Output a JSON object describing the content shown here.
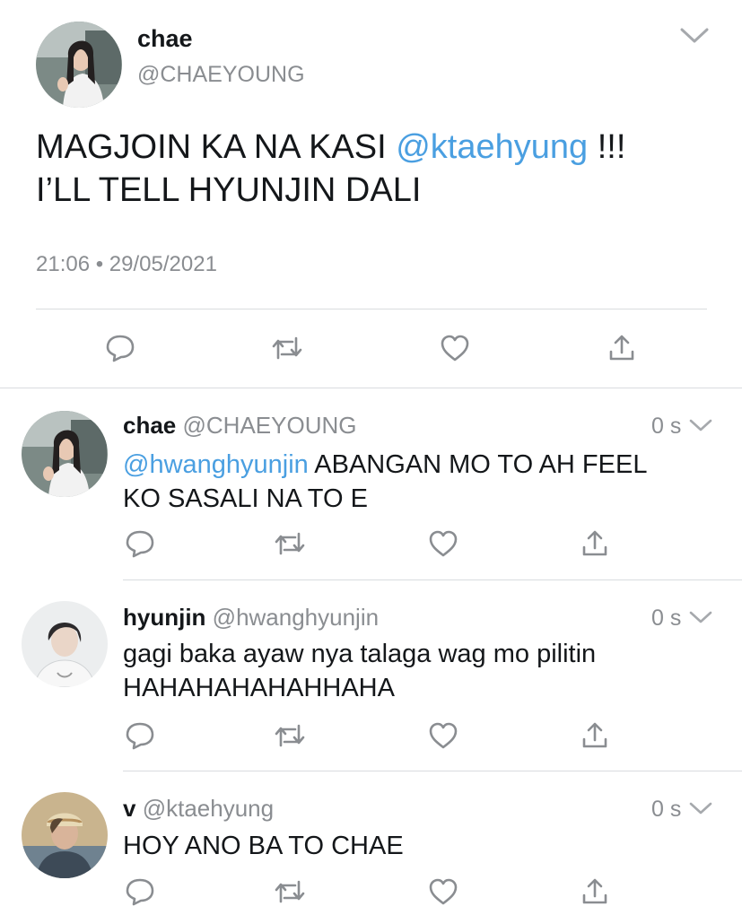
{
  "main_tweet": {
    "name": "chae",
    "handle": "@CHAEYOUNG",
    "text_before": "MAGJOIN KA NA KASI ",
    "mention": "@ktaehyung",
    "text_after": " !!!",
    "line2": "I’LL TELL HYUNJIN DALI",
    "timestamp": "21:06 • 29/05/2021"
  },
  "replies": [
    {
      "name": "chae",
      "handle": "@CHAEYOUNG",
      "time": "0 s",
      "mention": "@hwanghyunjin",
      "line1_rest": " ABANGAN MO TO AH FEEL",
      "line2": "KO SASALI NA TO E"
    },
    {
      "name": "hyunjin",
      "handle": "@hwanghyunjin",
      "time": "0 s",
      "line1": "gagi baka ayaw nya talaga wag mo pilitin",
      "line2": "HAHAHAHAHAHHAHA"
    },
    {
      "name": "v",
      "handle": "@ktaehyung",
      "time": "0 s",
      "line1": "HOY ANO BA TO CHAE"
    }
  ],
  "icons": {
    "reply": "speech-bubble",
    "retweet": "retweet-arrows",
    "like": "heart",
    "share": "upload-arrow",
    "more": "chevron-down"
  },
  "colors": {
    "mention": "#4a9fe1",
    "secondary_text": "#8a8d91",
    "divider": "#d9dcdf"
  }
}
